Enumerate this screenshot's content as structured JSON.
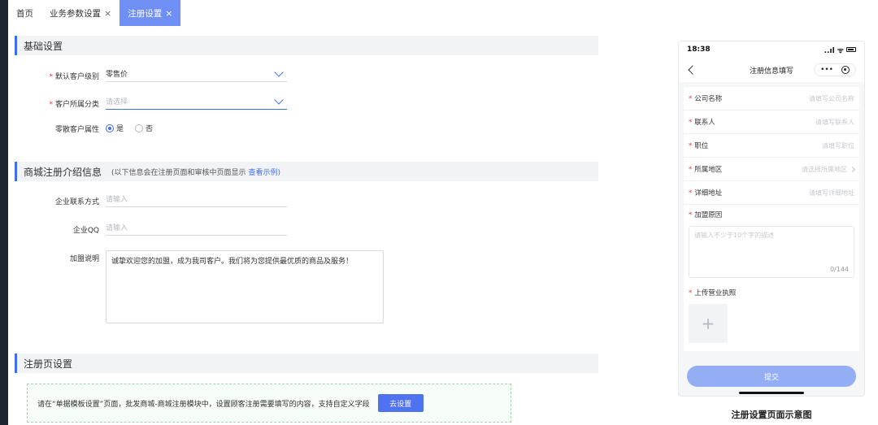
{
  "tabs": [
    {
      "label": "首页",
      "closable": false
    },
    {
      "label": "业务参数设置",
      "closable": true
    },
    {
      "label": "注册设置",
      "closable": true,
      "active": true
    }
  ],
  "close_glyph": "×",
  "basic": {
    "title": "基础设置",
    "default_level_label": "默认客户级别",
    "default_level_value": "零售价",
    "category_label": "客户所属分类",
    "category_placeholder": "请选择",
    "retail_label": "零散客户属性",
    "retail_yes": "是",
    "retail_no": "否",
    "retail_selected": "是"
  },
  "intro": {
    "title": "商城注册介绍信息",
    "note": "(以下信息会在注册页面和审核中页面显示",
    "link": "查看示例)",
    "contact_label": "企业联系方式",
    "contact_placeholder": "请输入",
    "qq_label": "企业QQ",
    "qq_placeholder": "请输入",
    "join_label": "加盟说明",
    "join_text": "诚挚欢迎您的加盟，成为我司客户。我们将为您提供最优质的商品及服务！"
  },
  "register_page": {
    "title": "注册页设置",
    "notice": "请在“单据模板设置”页面，批发商城-商城注册模块中，设置顾客注册需要填写的内容，支持自定义字段",
    "button": "去设置"
  },
  "phone": {
    "time": "18:38",
    "signal": "..ıl ᯤ",
    "title": "注册信息填写",
    "more": "•••",
    "fields": [
      {
        "label": "公司名称",
        "placeholder": "请填写公司名称",
        "arrow": false
      },
      {
        "label": "联系人",
        "placeholder": "请填写联系人",
        "arrow": false
      },
      {
        "label": "职位",
        "placeholder": "请填写职位",
        "arrow": false
      },
      {
        "label": "所属地区",
        "placeholder": "请选择所属地区",
        "arrow": true
      },
      {
        "label": "详细地址",
        "placeholder": "请填写详细地址",
        "arrow": false
      }
    ],
    "reason_label": "加盟原因",
    "reason_placeholder": "请输入不少于10个字的描述",
    "reason_counter": "0/144",
    "license_label": "上传营业执照",
    "upload_plus": "+",
    "submit": "提交",
    "required_mark": "*"
  },
  "caption": "注册设置页面示意图",
  "colors": {
    "accent": "#3f6df0",
    "tab_active": "#6f8ff5",
    "required": "#e43b3b",
    "notice_border": "#9fd9a8"
  }
}
